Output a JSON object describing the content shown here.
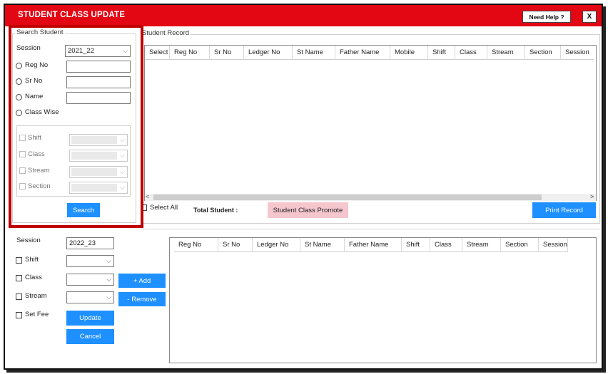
{
  "window": {
    "title": "STUDENT CLASS UPDATE",
    "help_label": "Need Help ?",
    "close_label": "X"
  },
  "search": {
    "group_title": "Search Student",
    "session_label": "Session",
    "session_value": "2021_22",
    "reg_no_label": "Reg No",
    "sr_no_label": "Sr No",
    "name_label": "Name",
    "class_wise_label": "Class Wise",
    "shift_label": "Shift",
    "class_label": "Class",
    "stream_label": "Stream",
    "section_label": "Section",
    "search_button": "Search"
  },
  "record": {
    "group_title": "Student Record",
    "columns": [
      "Select",
      "Reg No",
      "Sr No",
      "Ledger No",
      "St Name",
      "Father Name",
      "Mobile",
      "Shift",
      "Class",
      "Stream",
      "Section",
      "Session"
    ],
    "scroll_left": "<",
    "scroll_right": ">",
    "select_all_label": "Select All",
    "total_label": "Total Student :",
    "promote_button": "Student Class Promote",
    "print_button": "Print Record"
  },
  "update": {
    "session_label": "Session",
    "session_value": "2022_23",
    "shift_label": "Shift",
    "class_label": "Class",
    "stream_label": "Stream",
    "set_fee_label": "Set Fee",
    "add_button": "+ Add",
    "remove_button": "- Remove",
    "update_button": "Update",
    "cancel_button": "Cancel",
    "columns": [
      "Reg No",
      "Sr No",
      "Ledger No",
      "St Name",
      "Father Name",
      "Shift",
      "Class",
      "Stream",
      "Section",
      "Session"
    ]
  }
}
